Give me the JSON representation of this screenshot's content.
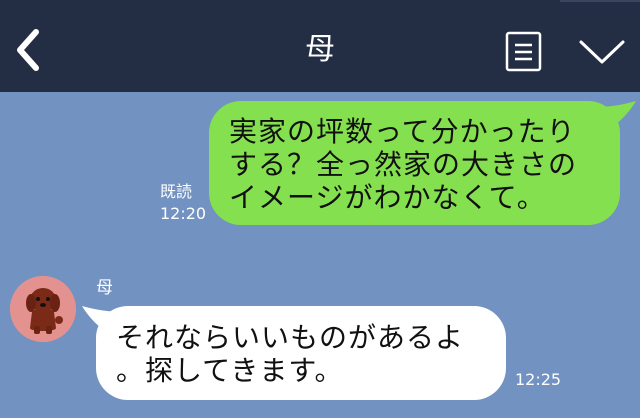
{
  "header": {
    "title": "母",
    "back_icon": "chevron-left-icon",
    "memo_icon": "note-icon",
    "menu_icon": "chevron-down-icon"
  },
  "messages": [
    {
      "direction": "outgoing",
      "text": "実家の坪数って分かったり\nする？全っ然家の大きさの\nイメージがわかなくて。",
      "read_label": "既読",
      "time": "12:20"
    },
    {
      "direction": "incoming",
      "sender": "母",
      "text": "それならいいものがあるよ\n。探してきます。",
      "time": "12:25"
    }
  ],
  "colors": {
    "header_bg": "#232d44",
    "chat_bg": "#7292c2",
    "outgoing_bubble": "#85e04f",
    "incoming_bubble": "#ffffff",
    "avatar_bg": "#e4928f"
  }
}
